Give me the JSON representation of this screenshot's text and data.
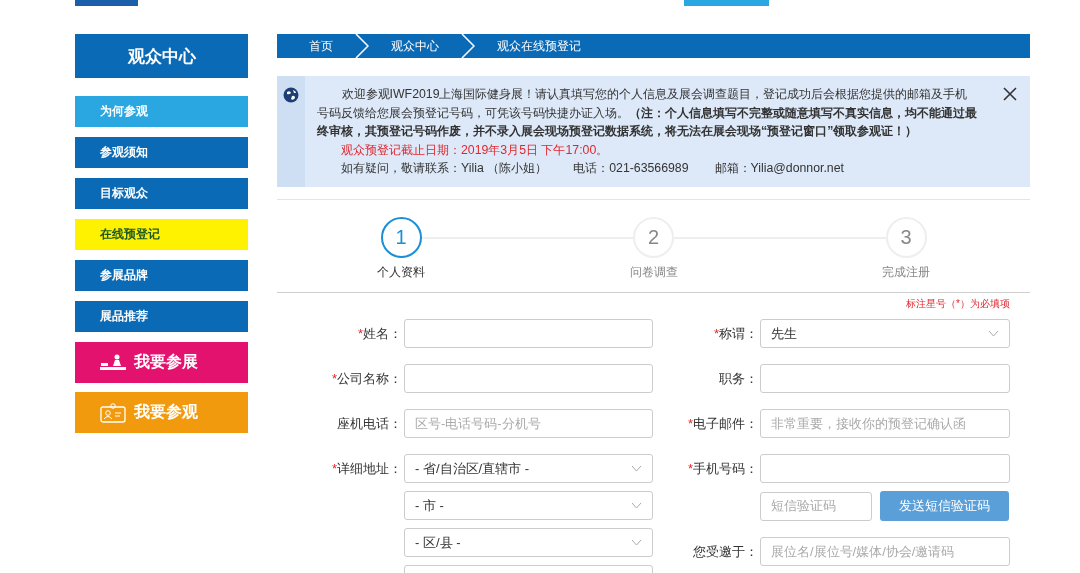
{
  "sidebar": {
    "title": "观众中心",
    "items": [
      {
        "label": "为何参观",
        "selected": false,
        "hovered": true
      },
      {
        "label": "参观须知",
        "selected": false,
        "hovered": false
      },
      {
        "label": "目标观众",
        "selected": false,
        "hovered": false
      },
      {
        "label": "在线预登记",
        "selected": true,
        "hovered": false
      },
      {
        "label": "参展品牌",
        "selected": false,
        "hovered": false
      },
      {
        "label": "展品推荐",
        "selected": false,
        "hovered": false
      }
    ],
    "actions": [
      {
        "label": "我要参展",
        "kind": "exhibit",
        "color": "#e4126f"
      },
      {
        "label": "我要参观",
        "kind": "visit",
        "color": "#f29a0e"
      }
    ]
  },
  "breadcrumb": [
    "首页",
    "观众中心",
    "观众在线预登记"
  ],
  "notice": {
    "text": "欢迎参观IWF2019上海国际健身展！请认真填写您的个人信息及展会调查题目，登记成功后会根据您提供的邮箱及手机号码反馈给您展会预登记号码，可凭该号码快捷办证入场。**（注：个人信息填写不完整或随意填写不真实信息，均不能通过最终审核，其预登记号码作废，并不录入展会现场预登记数据系统，将无法在展会现场“预登记窗口”领取参观证！）**",
    "deadline": "观众预登记截止日期：2019年3月5日 下午17:00。",
    "contacts": [
      "如有疑问，敬请联系：Yilia （陈小姐）",
      "电话：021-63566989",
      "邮箱：Yilia@donnor.net"
    ]
  },
  "steps": [
    {
      "number": "1",
      "label": "个人资料",
      "selected": true
    },
    {
      "number": "2",
      "label": "问卷调查",
      "selected": false
    },
    {
      "number": "3",
      "label": "完成注册",
      "selected": false
    }
  ],
  "required_note": "标注星号（*）为必填项",
  "form": {
    "left": [
      {
        "label": "姓名：",
        "star": "*",
        "kind": "input"
      },
      {
        "label": "公司名称：",
        "star": "*",
        "kind": "input"
      },
      {
        "label": "座机电话：",
        "kind": "input",
        "placeholder": "区号-电话号码-分机号"
      },
      {
        "label": "详细地址：",
        "star": "*",
        "kind": "select",
        "value": "- 省/自治区/直辖市 -"
      },
      {
        "kind": "select",
        "value": "- 市 -"
      },
      {
        "kind": "select",
        "value": "- 区/县 -"
      },
      {
        "kind": "input"
      }
    ],
    "right": [
      {
        "label": "称谓：",
        "star": "*",
        "kind": "select",
        "value": "先生"
      },
      {
        "label": "职务：",
        "kind": "input"
      },
      {
        "label": "电子邮件：",
        "star": "*",
        "kind": "input",
        "placeholder": "非常重要，接收你的预登记确认函"
      },
      {
        "label": "手机号码：",
        "star": "*",
        "kind": "input"
      },
      {
        "kind": "code",
        "placeholder": "短信验证码",
        "button": "发送短信验证码"
      },
      {
        "label": "您受邀于：",
        "kind": "input",
        "placeholder": "展位名/展位号/媒体/协会/邀请码"
      }
    ]
  }
}
